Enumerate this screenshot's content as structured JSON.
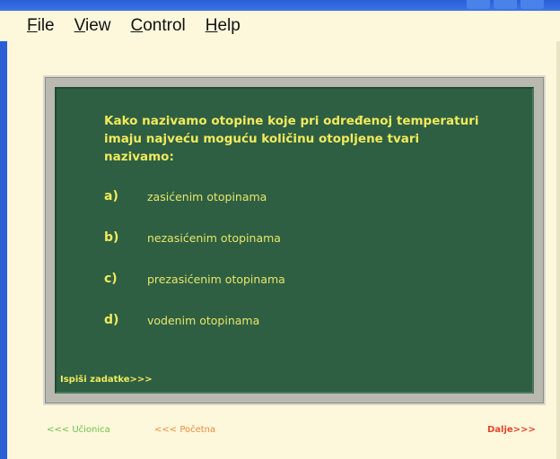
{
  "menu": {
    "items": [
      {
        "underline": "F",
        "rest": "ile"
      },
      {
        "underline": "V",
        "rest": "iew"
      },
      {
        "underline": "C",
        "rest": "ontrol"
      },
      {
        "underline": "H",
        "rest": "elp"
      }
    ]
  },
  "board": {
    "question_line1": "Kako nazivamo otopine koje pri određenoj temperaturi",
    "question_line2": "imaju najveću moguću količinu otopljene tvari",
    "question_line3": "nazivamo:",
    "answers": [
      {
        "letter": "a)",
        "text": "zasićenim otopinama"
      },
      {
        "letter": "b)",
        "text": "nezasićenim otopinama"
      },
      {
        "letter": "c)",
        "text": "prezasićenim otopinama"
      },
      {
        "letter": "d)",
        "text": "vodenim otopinama"
      }
    ],
    "task_link": "Ispiši zadatke>>>"
  },
  "nav": {
    "back": "<<< Učionica",
    "start": "<<< Početna",
    "next": "Dalje>>>"
  },
  "colors": {
    "background": "#fdf8dc",
    "chalkboard": "#2e5f43",
    "chalk_yellow": "#f1ea5c",
    "nav_green": "#6ec04a",
    "nav_orange": "#f08a3c",
    "nav_red": "#e0462a"
  }
}
